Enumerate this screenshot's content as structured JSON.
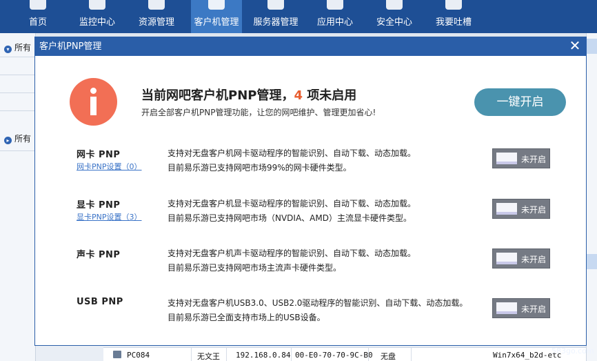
{
  "nav": {
    "items": [
      {
        "label": "首页"
      },
      {
        "label": "监控中心"
      },
      {
        "label": "资源管理"
      },
      {
        "label": "客户机管理"
      },
      {
        "label": "服务器管理"
      },
      {
        "label": "应用中心"
      },
      {
        "label": "安全中心"
      },
      {
        "label": "我要吐槽"
      }
    ],
    "active": "客户机管理"
  },
  "background": {
    "left_groups": [
      "所有",
      "所有"
    ],
    "bottom_row": {
      "name": "PC084",
      "user": "无文王",
      "ip": "192.168.0.84",
      "mac": "00-E0-70-70-9C-B0",
      "disk": "无盘",
      "os": "Win7x64_b2d-etc"
    },
    "watermark": "583go.com"
  },
  "dialog": {
    "title": "客户机PNP管理",
    "close_symbol": "✕",
    "headline_prefix": "当前网吧客户机PNP管理，",
    "headline_count": "4",
    "headline_suffix": " 项未启用",
    "subline": "开启全部客户机PNP管理功能，让您的网吧维护、管理更加省心!",
    "one_key_button": "一键开启",
    "items": [
      {
        "name": "网卡 PNP",
        "link": "网卡PNP设置（0）",
        "desc1": "支持对无盘客户机网卡驱动程序的智能识别、自动下载、动态加载。",
        "desc2": "目前易乐游已支持网吧市场99%的网卡硬件类型。",
        "toggle": "未开启"
      },
      {
        "name": "显卡 PNP",
        "link": "显卡PNP设置（3）",
        "desc1": "支持对无盘客户机显卡驱动程序的智能识别、自动下载、动态加载。",
        "desc2": "目前易乐游已支持网吧市场（NVDIA、AMD）主流显卡硬件类型。",
        "toggle": "未开启"
      },
      {
        "name": "声卡 PNP",
        "link": "",
        "desc1": "支持对无盘客户机声卡驱动程序的智能识别、自动下载、动态加载。",
        "desc2": "目前易乐游已支持网吧市场主流声卡硬件类型。",
        "toggle": "未开启"
      },
      {
        "name": "USB PNP",
        "link": "",
        "desc1": "支持对无盘客户机USB3.0、USB2.0驱动程序的智能识别、自动下载、动态加载。",
        "desc2": "目前易乐游已全面支持市场上的USB设备。",
        "toggle": "未开启"
      }
    ]
  }
}
